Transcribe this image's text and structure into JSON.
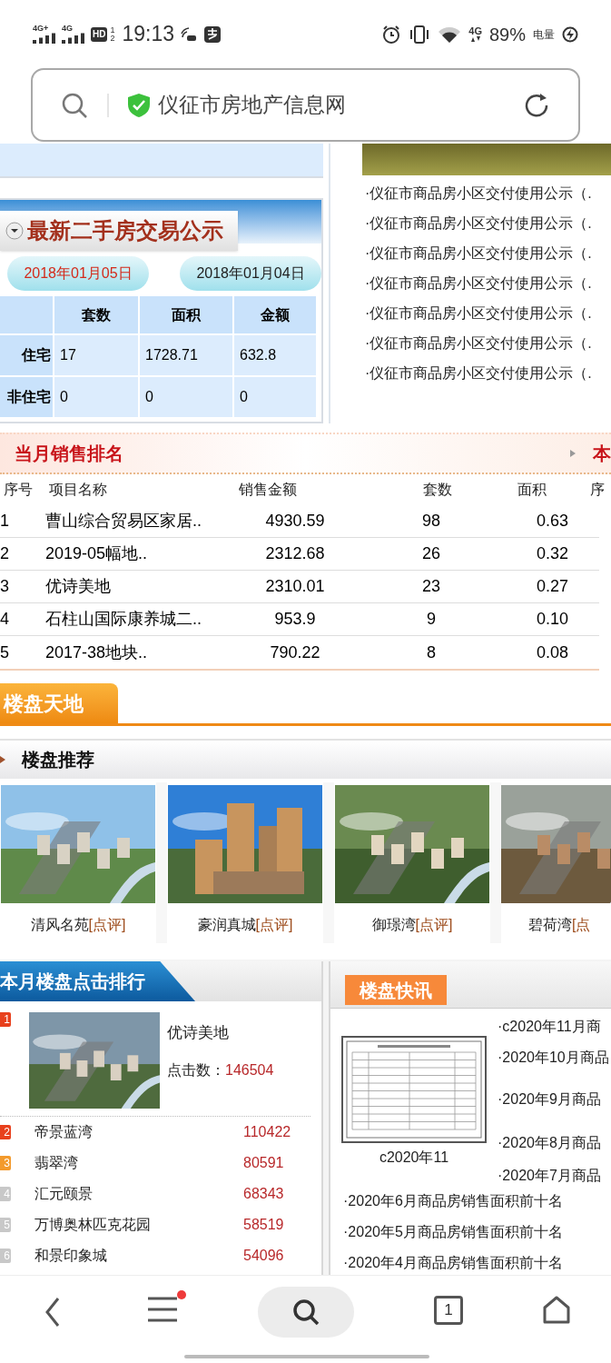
{
  "status_bar": {
    "network_labels": [
      "4G+",
      "4G"
    ],
    "hd": "HD",
    "sim_slots": [
      "1",
      "2"
    ],
    "time": "19:13",
    "data_label": "4G",
    "battery": "89%",
    "battery_label": "电量"
  },
  "address_bar": {
    "title": "仪征市房地产信息网"
  },
  "second_hand": {
    "title": "最新二手房交易公示",
    "dates": [
      {
        "label": "2018年01月05日",
        "selected": true
      },
      {
        "label": "2018年01月04日",
        "selected": false
      }
    ],
    "columns": [
      "套数",
      "面积",
      "金额"
    ],
    "rows": [
      {
        "label": "住宅",
        "values": [
          "17",
          "1728.71",
          "632.8"
        ]
      },
      {
        "label": "非住宅",
        "values": [
          "0",
          "0",
          "0"
        ]
      }
    ]
  },
  "notices": {
    "items": [
      "·仪征市商品房小区交付使用公示（.",
      "·仪征市商品房小区交付使用公示（.",
      "·仪征市商品房小区交付使用公示（.",
      "·仪征市商品房小区交付使用公示（.",
      "·仪征市商品房小区交付使用公示（.",
      "·仪征市商品房小区交付使用公示（.",
      "·仪征市商品房小区交付使用公示（."
    ]
  },
  "sales_ranking": {
    "title": "当月销售排名",
    "side_title": "本",
    "columns": [
      "序号",
      "项目名称",
      "销售金额",
      "套数",
      "面积",
      "序"
    ],
    "rows": [
      [
        "1",
        "曹山综合贸易区家居..",
        "4930.59",
        "98",
        "0.63"
      ],
      [
        "2",
        "2019-05幅地..",
        "2312.68",
        "26",
        "0.32"
      ],
      [
        "3",
        "优诗美地",
        "2310.01",
        "23",
        "0.27"
      ],
      [
        "4",
        "石柱山国际康养城二..",
        "953.9",
        "9",
        "0.10"
      ],
      [
        "5",
        "2017-38地块..",
        "790.22",
        "8",
        "0.08"
      ]
    ]
  },
  "estates": {
    "tab": "楼盘天地",
    "recommend_title": "楼盘推荐",
    "items": [
      {
        "name": "清风名苑",
        "review": "[点评]",
        "kind": "picture"
      },
      {
        "name": "豪润真城",
        "review": "[点评]",
        "kind": "picture"
      },
      {
        "name": "御璟湾",
        "review": "[点评]",
        "kind": "picture"
      },
      {
        "name": "碧荷湾",
        "review": "[点",
        "kind": "picture"
      }
    ]
  },
  "click_ranking": {
    "title": "本月楼盘点击排行",
    "top": {
      "rank": "1",
      "name": "优诗美地",
      "clicks_label": "点击数：",
      "clicks": "146504",
      "color": "#e8401c"
    },
    "items": [
      {
        "rank": "2",
        "name": "帝景蓝湾",
        "clicks": "110422",
        "color": "#e8401c"
      },
      {
        "rank": "3",
        "name": "翡翠湾",
        "clicks": "80591",
        "color": "#f39a2c"
      },
      {
        "rank": "4",
        "name": "汇元颐景",
        "clicks": "68343",
        "color": "#c8c8c8"
      },
      {
        "rank": "5",
        "name": "万博奥林匹克花园",
        "clicks": "58519",
        "color": "#c8c8c8"
      },
      {
        "rank": "6",
        "name": "和景印象城",
        "clicks": "54096",
        "color": "#c8c8c8"
      }
    ]
  },
  "news": {
    "title": "楼盘快讯",
    "thumbnail_caption": "c2020年11",
    "side_items": [
      "·c2020年11月商",
      "·2020年10月商品",
      "·2020年9月商品",
      "·2020年8月商品",
      "·2020年7月商品"
    ],
    "items": [
      "·2020年6月商品房销售面积前十名",
      "·2020年5月商品房销售面积前十名",
      "·2020年4月商品房销售面积前十名"
    ]
  },
  "bottom_nav": {
    "tab_count": "1",
    "menu_badge": true
  }
}
